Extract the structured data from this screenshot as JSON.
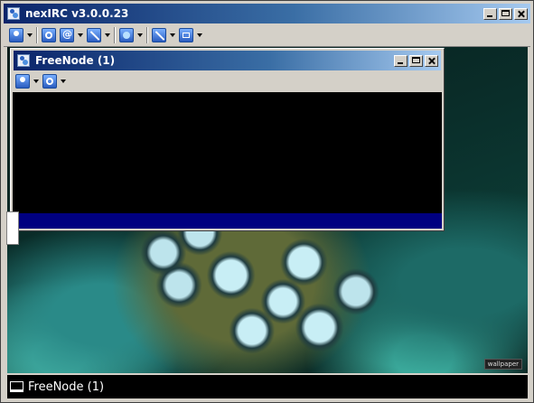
{
  "app": {
    "title": "nexIRC v3.0.0.23",
    "toolbar": [
      {
        "icon": "user-icon",
        "has_dropdown": true
      },
      {
        "icon": "settings-icon",
        "has_dropdown": false
      },
      {
        "icon": "at-icon",
        "has_dropdown": true
      },
      {
        "icon": "wand-icon",
        "has_dropdown": true
      },
      {
        "icon": "globe-icon",
        "has_dropdown": true
      },
      {
        "icon": "tools-icon",
        "has_dropdown": true
      },
      {
        "icon": "window-icon",
        "has_dropdown": true
      }
    ]
  },
  "child_window": {
    "title": "FreeNode (1)",
    "toolbar": [
      {
        "icon": "user-icon",
        "has_dropdown": true
      },
      {
        "icon": "settings-icon",
        "has_dropdown": true
      }
    ],
    "colors": {
      "chat_bg": "#000000",
      "input_bg": "#000080"
    }
  },
  "taskbar": {
    "items": [
      {
        "label": "FreeNode (1)",
        "icon": "window-icon"
      }
    ]
  },
  "desktop": {
    "watermark": "wallpaper"
  },
  "colors": {
    "titlebar_start": "#0a246a",
    "titlebar_end": "#a6caf0",
    "chrome": "#d4d0c8"
  }
}
